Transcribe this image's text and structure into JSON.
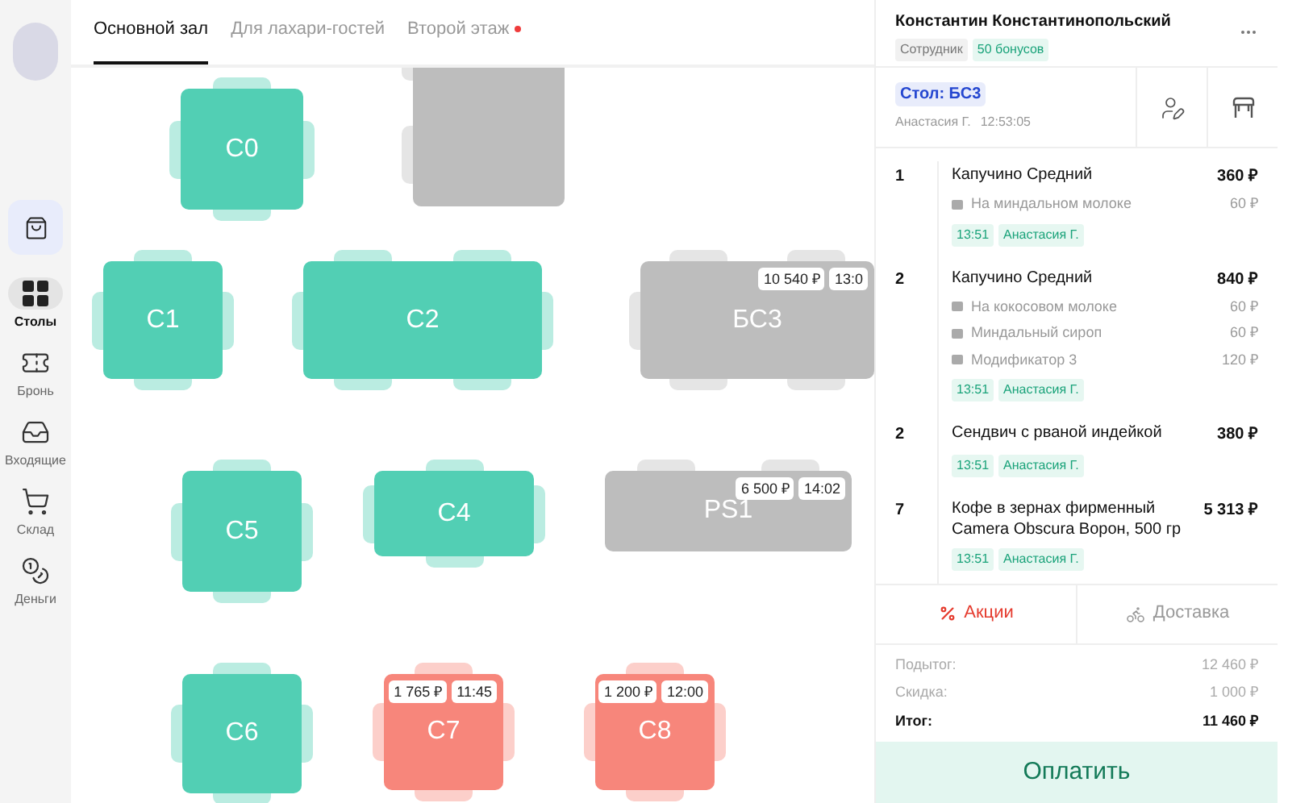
{
  "sidebar": {
    "items": [
      {
        "label": "Столы",
        "kind": "tables",
        "selected": true
      },
      {
        "label": "Бронь",
        "kind": "booking",
        "selected": false
      },
      {
        "label": "Входящие",
        "kind": "inbox",
        "selected": false
      },
      {
        "label": "Склад",
        "kind": "stock",
        "selected": false
      },
      {
        "label": "Деньги",
        "kind": "money",
        "selected": false
      }
    ]
  },
  "tabs": [
    {
      "label": "Основной зал",
      "selected": true,
      "alert": false
    },
    {
      "label": "Для лахари-гостей",
      "selected": false,
      "alert": false
    },
    {
      "label": "Второй этаж",
      "selected": false,
      "alert": true
    }
  ],
  "tables": [
    {
      "label": "С0",
      "color": "#52cfb4"
    },
    {
      "color": "#bdbdbd"
    },
    {
      "label": "С1",
      "color": "#52cfb4"
    },
    {
      "label": "С2",
      "color": "#52cfb4"
    },
    {
      "label": "БС3",
      "color": "#bdbdbd",
      "amount": "10 540 ₽",
      "time": "13:0"
    },
    {
      "label": "С5",
      "color": "#52cfb4"
    },
    {
      "label": "С4",
      "color": "#52cfb4"
    },
    {
      "label": "PS1",
      "color": "#bdbdbd",
      "amount": "6 500 ₽",
      "time": "14:02"
    },
    {
      "label": "С6",
      "color": "#52cfb4"
    },
    {
      "label": "С7",
      "color": "#f7867b",
      "amount": "1 765 ₽",
      "time": "11:45"
    },
    {
      "label": "С8",
      "color": "#f7867b",
      "amount": "1 200 ₽",
      "time": "12:00"
    }
  ],
  "order": {
    "customer": "Константин Константинопольский",
    "role": "Сотрудник",
    "bonus": "50 бонусов",
    "table": "Стол: БС3",
    "waiter": "Анастасия Г.",
    "opened": "12:53:05",
    "items": [
      {
        "qty": "1",
        "name": "Капучино Средний",
        "price": "360 ₽",
        "modifiers": [
          {
            "name": "На миндальном молоке",
            "price": "60 ₽"
          }
        ],
        "time": "13:51",
        "waiter": "Анастасия Г."
      },
      {
        "qty": "2",
        "name": "Капучино Средний",
        "price": "840 ₽",
        "modifiers": [
          {
            "name": "На кокосовом молоке",
            "price": "60 ₽"
          },
          {
            "name": "Миндальный сироп",
            "price": "60 ₽"
          },
          {
            "name": "Модификатор 3",
            "price": "120 ₽"
          }
        ],
        "time": "13:51",
        "waiter": "Анастасия Г."
      },
      {
        "qty": "2",
        "name": "Сендвич с рваной индейкой",
        "price": "380 ₽",
        "time": "13:51",
        "waiter": "Анастасия Г."
      },
      {
        "qty": "7",
        "name": "Кофе в зернах фирменный Camera Obscura Ворон, 500 гр",
        "price": "5 313 ₽",
        "time": "13:51",
        "waiter": "Анастасия Г."
      }
    ],
    "promo": "Акции",
    "delivery": "Доставка",
    "totals": [
      {
        "label": "Подытог:",
        "value": "12 460 ₽",
        "kind": "sub"
      },
      {
        "label": "Скидка:",
        "value": "1 000 ₽",
        "kind": "sub"
      },
      {
        "label": "Итог:",
        "value": "11 460 ₽",
        "kind": "total"
      }
    ],
    "pay": "Оплатить"
  }
}
